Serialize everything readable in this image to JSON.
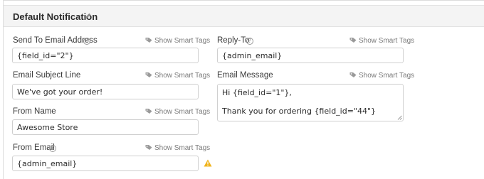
{
  "header": {
    "title": "Default Notification",
    "edit_icon": "pencil-icon"
  },
  "smart_tags_label": "Show Smart Tags",
  "help_glyph": "?",
  "left": {
    "send_to": {
      "label": "Send To Email Address",
      "value": "{field_id=\"2\"}"
    },
    "subject": {
      "label": "Email Subject Line",
      "value": "We've got your order!"
    },
    "from_name": {
      "label": "From Name",
      "value": "Awesome Store"
    },
    "from_email": {
      "label": "From Email",
      "value": "{admin_email}",
      "status_icon": "warning-icon"
    }
  },
  "right": {
    "reply_to": {
      "label": "Reply-To",
      "value": "{admin_email}"
    },
    "message": {
      "label": "Email Message",
      "line1": "Hi {field_id=\"1\"},",
      "line2": "Thank you for ordering {field_id=\"44\"}"
    }
  },
  "colors": {
    "warning": "#f0b31a",
    "header_bg": "#f4f4f4",
    "border": "#cfcfcf"
  }
}
